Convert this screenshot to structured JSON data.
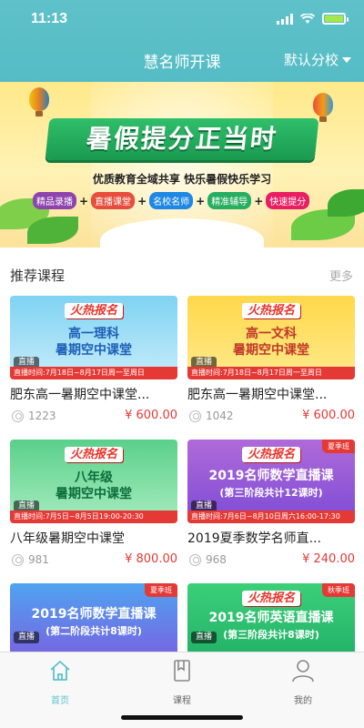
{
  "status": {
    "time": "11:13"
  },
  "nav": {
    "title": "慧名师开课",
    "campus": "默认分校"
  },
  "banner": {
    "title": "暑假提分正当时",
    "subtitle": "优质教育全域共享  快乐暑假快乐学习",
    "tags": [
      "精品录播",
      "直播课堂",
      "名校名师",
      "精准辅导",
      "快速提分"
    ],
    "tag_colors": [
      "#8e44ad",
      "#e74c3c",
      "#1e88e5",
      "#27ae60",
      "#e91e63"
    ]
  },
  "section": {
    "title": "推荐课程",
    "more": "更多"
  },
  "courses": [
    {
      "hot": "火热报名",
      "thumb_title": [
        "高一理科",
        "暑期空中课堂"
      ],
      "live": "直播",
      "schedule": "直播时间:7月18日~8月17日周一至周日",
      "ribbon": "",
      "name": "肥东高一暑期空中课堂...",
      "count": "1223",
      "price": "¥ 600.00"
    },
    {
      "hot": "火热报名",
      "thumb_title": [
        "高一文科",
        "暑期空中课堂"
      ],
      "live": "直播",
      "schedule": "直播时间:7月18日~8月17日周一至周日",
      "ribbon": "",
      "name": "肥东高一暑期空中课堂...",
      "count": "1042",
      "price": "¥ 600.00"
    },
    {
      "hot": "火热报名",
      "thumb_title": [
        "八年级",
        "暑期空中课堂"
      ],
      "live": "直播",
      "schedule": "直播时间:7月5日~8月5日19:00-20:30",
      "ribbon": "",
      "name": "八年级暑期空中课堂",
      "count": "981",
      "price": "¥ 800.00"
    },
    {
      "hot": "火热报名",
      "thumb_title": [
        "2019名师数学直播课",
        "(第三阶段共计12课时)"
      ],
      "live": "直播",
      "schedule": "直播时间:7月6日~8月10日周六16:00-17:30",
      "ribbon": "夏季班",
      "name": "2019夏季数学名师直...",
      "count": "968",
      "price": "¥ 240.00"
    },
    {
      "hot": "火热报名",
      "thumb_title": [
        "2019名师数学直播课",
        "(第二阶段共计8课时)"
      ],
      "live": "直播",
      "schedule": "",
      "ribbon": "夏季班",
      "name": "",
      "count": "",
      "price": ""
    },
    {
      "hot": "火热报名",
      "thumb_title": [
        "2019名师英语直播课",
        "(第三阶段共计8课时)"
      ],
      "live": "直播",
      "schedule": "",
      "ribbon": "秋季班",
      "name": "",
      "count": "",
      "price": ""
    }
  ],
  "tabs": [
    {
      "label": "首页",
      "icon": "home-icon",
      "active": true
    },
    {
      "label": "课程",
      "icon": "book-icon",
      "active": false
    },
    {
      "label": "我的",
      "icon": "user-icon",
      "active": false
    }
  ],
  "colors": {
    "accent": "#5fc1c9",
    "price": "#e53935"
  }
}
